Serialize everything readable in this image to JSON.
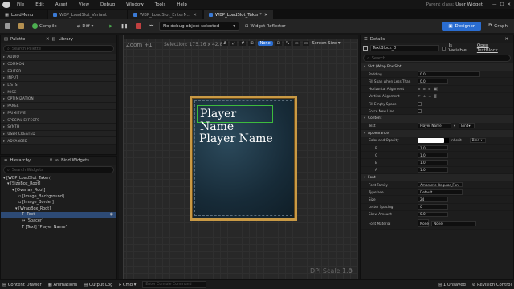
{
  "menu": {
    "items": [
      "File",
      "Edit",
      "Asset",
      "View",
      "Debug",
      "Window",
      "Tools",
      "Help"
    ],
    "parent_class_label": "Parent class:",
    "parent_class": "User Widget"
  },
  "tabs": [
    {
      "label": "LoadMenu"
    },
    {
      "label": "WBP_LoadSlot_Variant"
    },
    {
      "label": "WBP_LoadSlot_EnterN..."
    },
    {
      "label": "WBP_LoadSlot_Taken*"
    }
  ],
  "toolbar": {
    "compile": "Compile",
    "diff": "Diff",
    "debug_object": "No debug object selected",
    "widget_reflector": "Widget Reflector",
    "designer": "Designer",
    "graph": "Graph"
  },
  "palette": {
    "title": "Palette",
    "library": "Library",
    "search_placeholder": "Search Palette",
    "categories": [
      "AUDIO",
      "COMMON",
      "EDITOR",
      "INPUT",
      "LISTS",
      "MISC",
      "OPTIMIZATION",
      "PANEL",
      "PRIMITIVE",
      "SPECIAL EFFECTS",
      "SYNTH",
      "USER CREATED",
      "ADVANCED"
    ]
  },
  "hierarchy": {
    "title": "Hierarchy",
    "bind_widgets": "Bind Widgets",
    "search_placeholder": "Search Widgets",
    "items": [
      "[WBP_LoadSlot_Taken]",
      "[SizeBox_Root]",
      "[Overlay_Root]",
      "[Image_Background]",
      "[Image_Border]",
      "[WrapBox_Root]",
      "Text",
      "[Spacer]",
      "[Text] \"Player Name\""
    ]
  },
  "canvas": {
    "zoom": "Zoom +1",
    "selection": "Selection: 175.16 x 42.88",
    "none": "None",
    "screen_size": "Screen Size",
    "dpi": "DPI Scale 1.0",
    "text1": "Player Name",
    "text2": "Player Name"
  },
  "details": {
    "title": "Details",
    "widget_name": "TextBlock_0",
    "is_variable": "Is Variable",
    "open_link": "Open TextBlock",
    "search_placeholder": "Search",
    "slot_section": "Slot (Wrap Box Slot)",
    "slot_rows": [
      {
        "label": "Padding",
        "value": "0.0"
      },
      {
        "label": "Fill Span when Less Than",
        "value": "0.0"
      },
      {
        "label": "Horizontal Alignment",
        "value": ""
      },
      {
        "label": "Vertical Alignment",
        "value": ""
      },
      {
        "label": "Fill Empty Space",
        "value": ""
      },
      {
        "label": "Force New Line",
        "value": ""
      }
    ],
    "content_section": "Content",
    "text_label": "Text",
    "text_value": "Player Name",
    "bind": "Bind",
    "appearance_section": "Appearance",
    "color_label": "Color and Opacity",
    "inherit": "Inherit",
    "rgba": [
      {
        "label": "R",
        "value": "1.0"
      },
      {
        "label": "G",
        "value": "1.0"
      },
      {
        "label": "B",
        "value": "1.0"
      },
      {
        "label": "A",
        "value": "1.0"
      }
    ],
    "font_section": "Font",
    "font_rows": [
      {
        "label": "Font Family",
        "value": "Amarante-Regular_Fon"
      },
      {
        "label": "Typeface",
        "value": "Default"
      },
      {
        "label": "Size",
        "value": "24"
      },
      {
        "label": "Letter Spacing",
        "value": "0"
      },
      {
        "label": "Skew Amount",
        "value": "0.0"
      },
      {
        "label": "Font Material",
        "value": "None"
      }
    ]
  },
  "status": {
    "content_drawer": "Content Drawer",
    "animations": "Animations",
    "output_log": "Output Log",
    "cmd": "Cmd",
    "cmd_placeholder": "Enter Console Command",
    "unsaved": "1 Unsaved",
    "revision_control": "Revision Control"
  }
}
